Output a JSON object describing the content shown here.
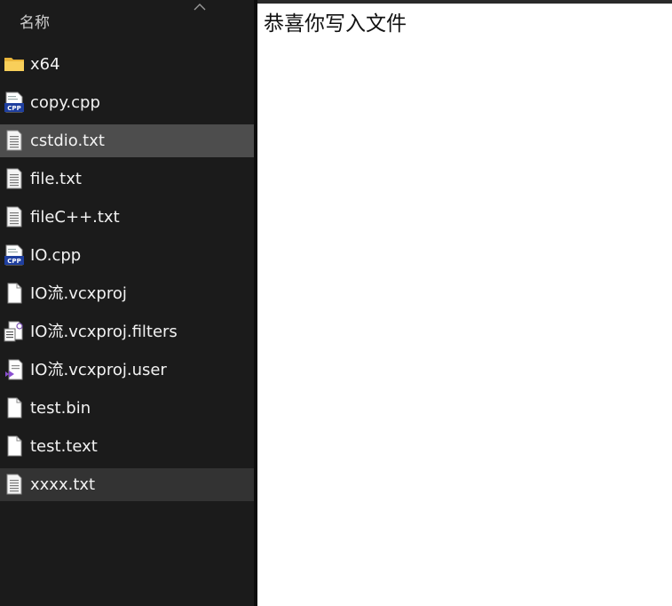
{
  "explorer": {
    "column_header": "名称",
    "files": [
      {
        "name": "x64",
        "icon": "folder-icon",
        "state": "normal"
      },
      {
        "name": "copy.cpp",
        "icon": "cpp-file-icon",
        "state": "normal"
      },
      {
        "name": "cstdio.txt",
        "icon": "text-file-icon",
        "state": "selected"
      },
      {
        "name": "file.txt",
        "icon": "text-file-icon",
        "state": "normal"
      },
      {
        "name": "fileC++.txt",
        "icon": "text-file-icon",
        "state": "normal"
      },
      {
        "name": "IO.cpp",
        "icon": "cpp-file-icon",
        "state": "normal"
      },
      {
        "name": "IO流.vcxproj",
        "icon": "blank-file-icon",
        "state": "normal"
      },
      {
        "name": "IO流.vcxproj.filters",
        "icon": "filters-file-icon",
        "state": "normal"
      },
      {
        "name": "IO流.vcxproj.user",
        "icon": "vs-user-file-icon",
        "state": "normal"
      },
      {
        "name": "test.bin",
        "icon": "blank-file-icon",
        "state": "normal"
      },
      {
        "name": "test.text",
        "icon": "blank-file-icon",
        "state": "normal"
      },
      {
        "name": "xxxx.txt",
        "icon": "text-file-icon",
        "state": "hovered"
      }
    ]
  },
  "editor": {
    "text": "恭喜你写入文件"
  },
  "colors": {
    "explorer_bg": "#1b1b1b",
    "selected_bg": "#4d4d4d",
    "hover_bg": "#333333",
    "editor_bg": "#ffffff",
    "folder": "#f8c84a",
    "cpp_badge": "#1f3f9f"
  }
}
